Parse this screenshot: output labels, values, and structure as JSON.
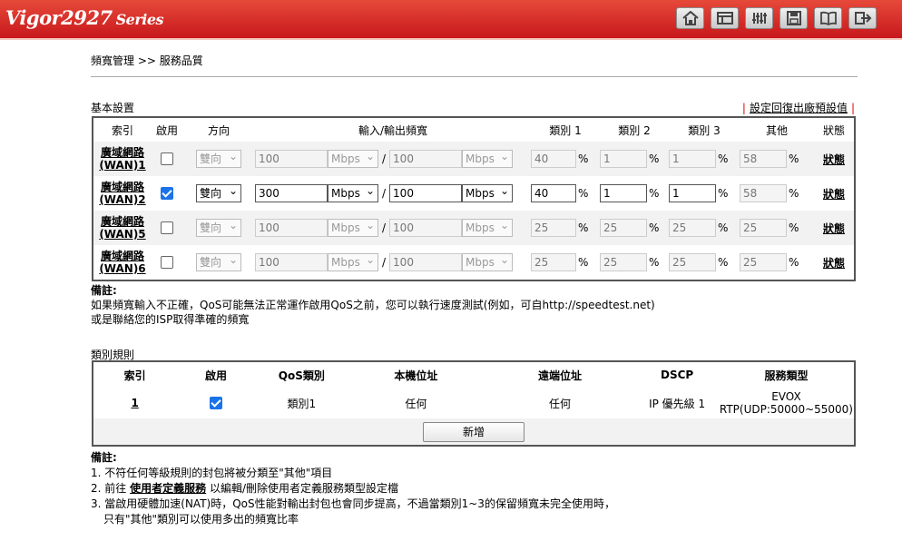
{
  "header": {
    "logo_main": "Vigor2927",
    "logo_series": "Series",
    "icons": [
      "home-icon",
      "table-icon",
      "sliders-icon",
      "save-icon",
      "book-icon",
      "logout-icon"
    ]
  },
  "breadcrumb": "頻寬管理 >> 服務品質",
  "basic": {
    "title": "基本設置",
    "reset_link": "設定回復出廠預設值",
    "headers": [
      "索引",
      "啟用",
      "方向",
      "輸入/輸出頻寬",
      "類別 1",
      "類別 2",
      "類別 3",
      "其他",
      "狀態"
    ],
    "rows": [
      {
        "index_line1": "廣域網路",
        "index_line2": "(WAN)1",
        "enabled": false,
        "direction": "雙向",
        "inbound": "100",
        "in_unit": "Mbps",
        "outbound": "100",
        "out_unit": "Mbps",
        "c1": "40",
        "c2": "1",
        "c3": "1",
        "other": "58",
        "status": "狀態",
        "active": false
      },
      {
        "index_line1": "廣域網路",
        "index_line2": "(WAN)2",
        "enabled": true,
        "direction": "雙向",
        "inbound": "300",
        "in_unit": "Mbps",
        "outbound": "100",
        "out_unit": "Mbps",
        "c1": "40",
        "c2": "1",
        "c3": "1",
        "other": "58",
        "status": "狀態",
        "active": true
      },
      {
        "index_line1": "廣域網路",
        "index_line2": "(WAN)5",
        "enabled": false,
        "direction": "雙向",
        "inbound": "100",
        "in_unit": "Mbps",
        "outbound": "100",
        "out_unit": "Mbps",
        "c1": "25",
        "c2": "25",
        "c3": "25",
        "other": "25",
        "status": "狀態",
        "active": false
      },
      {
        "index_line1": "廣域網路",
        "index_line2": "(WAN)6",
        "enabled": false,
        "direction": "雙向",
        "inbound": "100",
        "in_unit": "Mbps",
        "outbound": "100",
        "out_unit": "Mbps",
        "c1": "25",
        "c2": "25",
        "c3": "25",
        "other": "25",
        "status": "狀態",
        "active": false
      }
    ],
    "slash": "/",
    "percent": "%"
  },
  "note1": {
    "title": "備註:",
    "line1": "如果頻寬輸入不正確，QoS可能無法正常運作啟用QoS之前，您可以執行速度測試(例如，可自http://speedtest.net)",
    "line2": "或是聯絡您的ISP取得準確的頻寬"
  },
  "class_rules": {
    "title": "類別規則",
    "headers": [
      "索引",
      "啟用",
      "QoS類別",
      "本機位址",
      "遠端位址",
      "DSCP",
      "服務類型"
    ],
    "row": {
      "index": "1",
      "enabled": true,
      "qos_class": "類別1",
      "local": "任何",
      "remote": "任何",
      "dscp": "IP 優先級 1",
      "service_line1": "EVOX",
      "service_line2": "RTP(UDP:50000~55000)"
    },
    "add_button": "新增"
  },
  "note2": {
    "title": "備註:",
    "item1": "1. 不符任何等級規則的封包將被分類至\"其他\"項目",
    "item2_prefix": "2. 前往",
    "item2_link": "使用者定義服務",
    "item2_suffix": "以編輯/刪除使用者定義服務類型設定檔",
    "item3_line1": "3. 當啟用硬體加速(NAT)時，QoS性能對輸出封包也會同步提高，不過當類別1~3的保留頻寬未完全使用時，",
    "item3_line2": "只有\"其他\"類別可以使用多出的頻寬比率"
  }
}
